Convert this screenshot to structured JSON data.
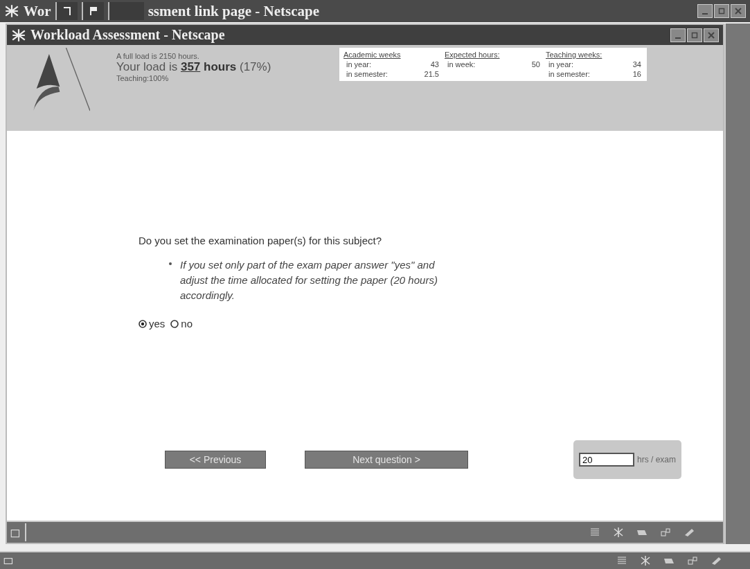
{
  "outer_window": {
    "title_left": "Wor",
    "title_right": "ssment link page - Netscape"
  },
  "window": {
    "title": "Workload Assessment - Netscape"
  },
  "header": {
    "full_load": "A full load is 2150 hours.",
    "load_prefix": "Your load is",
    "load_value": "357",
    "load_unit": "hours",
    "load_percent": "(17%)",
    "teaching": "Teaching:100%",
    "stats": [
      {
        "heading": "Academic weeks",
        "rows": [
          {
            "label": "in year:",
            "value": "43"
          },
          {
            "label": "in semester:",
            "value": "21.5"
          }
        ]
      },
      {
        "heading": "Expected hours:",
        "rows": [
          {
            "label": "in week:",
            "value": "50"
          }
        ]
      },
      {
        "heading": "Teaching weeks:",
        "rows": [
          {
            "label": "in year:",
            "value": "34"
          },
          {
            "label": "in semester:",
            "value": "16"
          }
        ]
      }
    ]
  },
  "question": {
    "text": "Do you set the examination paper(s) for this subject?",
    "note": "If you set only part of the exam paper answer \"yes\" and adjust the time allocated for setting the paper (20 hours) accordingly.",
    "options": [
      {
        "label": "yes",
        "selected": true
      },
      {
        "label": "no",
        "selected": false
      }
    ]
  },
  "buttons": [
    {
      "label": "<< Previous",
      "disabled": true
    },
    {
      "label": "Next question >",
      "disabled": true
    }
  ],
  "hours_field": {
    "value": "20",
    "unit": "hrs / exam"
  }
}
